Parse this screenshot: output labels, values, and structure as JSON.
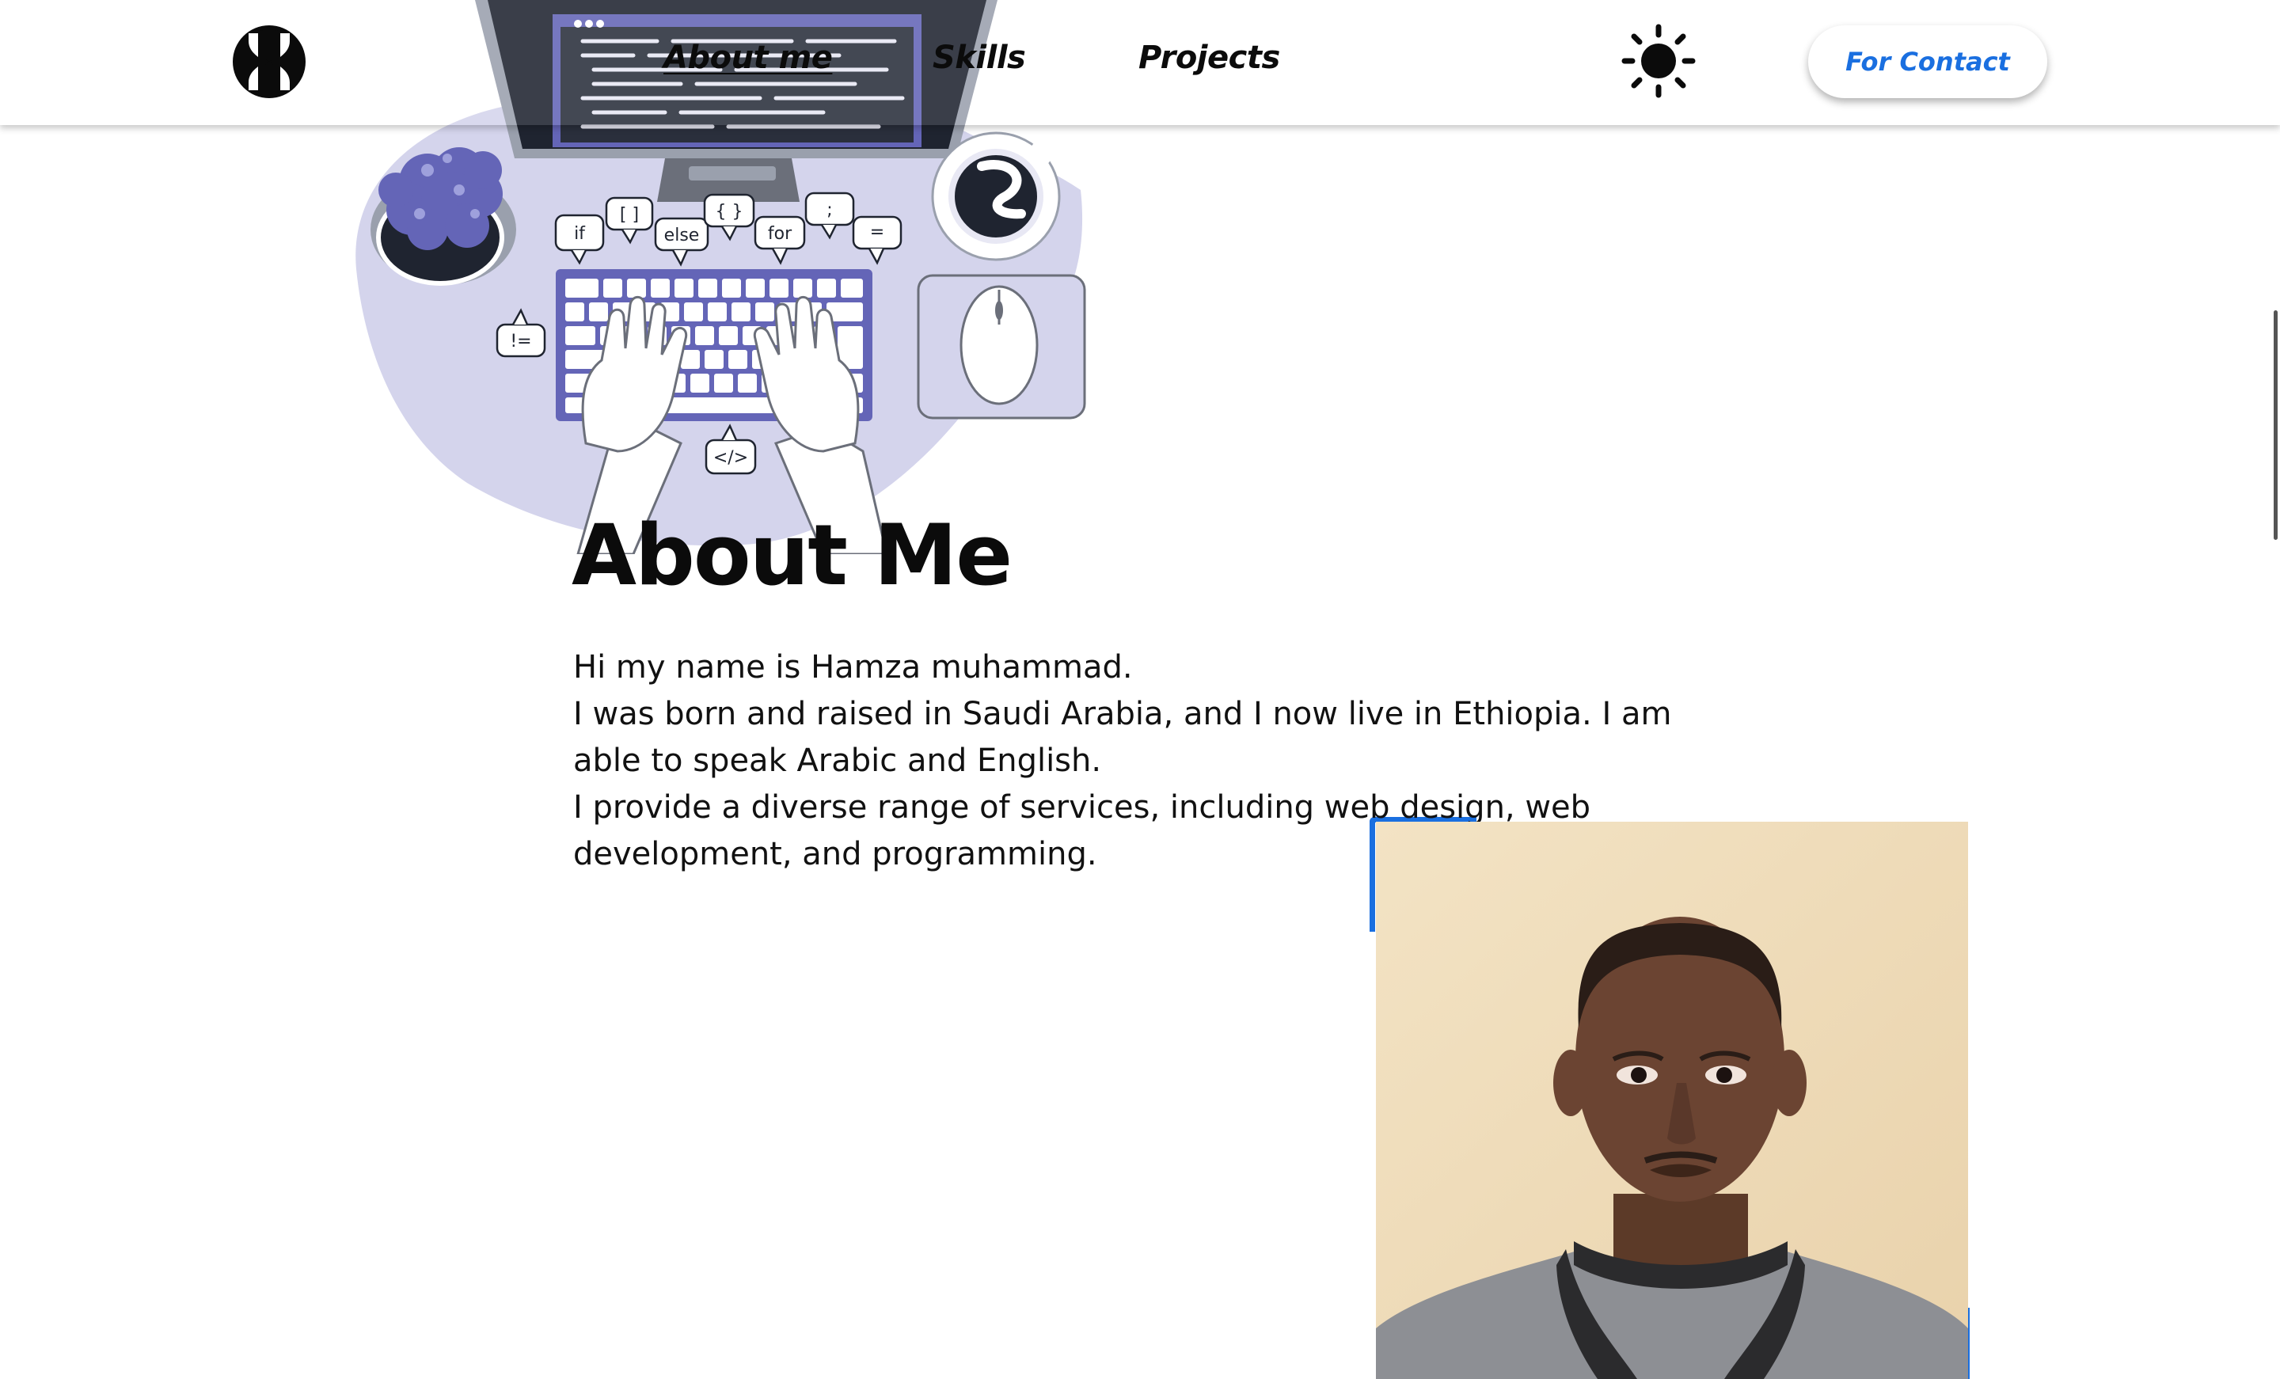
{
  "header": {
    "logo_icon": "hourglass-logo-icon",
    "nav": [
      {
        "label": "About me"
      },
      {
        "label": "Skills"
      },
      {
        "label": "Projects"
      }
    ],
    "theme_icon": "sun-icon",
    "contact_label": "For Contact"
  },
  "illustration": {
    "icon": "developer-desk-illustration",
    "bubbles": [
      "if",
      "[ ]",
      "else",
      "{ }",
      "for",
      ";",
      "=",
      "!=",
      "</>"
    ]
  },
  "about": {
    "title": "About Me",
    "paragraphs": [
      "Hi my name is Hamza muhammad.",
      "I was born and raised in Saudi Arabia, and I now live in Ethiopia. I am able to speak Arabic and English.",
      "I provide a diverse range of services, including web design, web development, and programming."
    ]
  },
  "photo": {
    "icon": "profile-photo"
  },
  "colors": {
    "accent": "#1a6fe0",
    "blob": "#d4d4ec",
    "keyboard": "#6465b7",
    "dark": "#1f2430"
  }
}
